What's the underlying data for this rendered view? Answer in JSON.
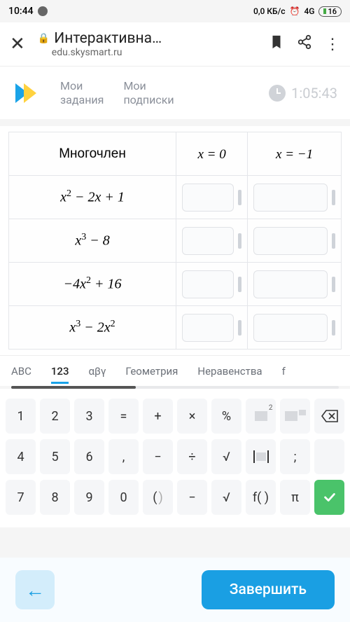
{
  "status": {
    "time": "10:44",
    "net_speed": "0,0 КБ/с",
    "signal": "4G",
    "battery": "16"
  },
  "browser": {
    "title": "Интерактивна…",
    "url": "edu.skysmart.ru"
  },
  "nav": {
    "tasks": "Мои\nзадания",
    "subs": "Мои\nподписки",
    "timer": "1:05:43"
  },
  "table": {
    "hdr_poly": "Многочлен",
    "hdr_c1": "x = 0",
    "hdr_c2": "x = −1",
    "rows": [
      {
        "poly_html": "x<sup>2</sup> − 2x + 1"
      },
      {
        "poly_html": "x<sup>3</sup> − 8"
      },
      {
        "poly_html": "−4x<sup>2</sup> + 16"
      },
      {
        "poly_html": "x<sup>3</sup> − 2x<sup>2</sup>"
      }
    ]
  },
  "kbd_tabs": {
    "t1": "ABC",
    "t2": "123",
    "t3": "αβγ",
    "t4": "Геометрия",
    "t5": "Неравенства",
    "t6": "f"
  },
  "keys": {
    "r1": [
      "1",
      "2",
      "3",
      "=",
      "+",
      "×",
      "%"
    ],
    "r2": [
      "4",
      "5",
      "6",
      ",",
      "−",
      "÷",
      "√"
    ],
    "r3": [
      "7",
      "8",
      "9",
      "0"
    ],
    "semicolon": ";",
    "minus_alt": "−",
    "root": "√",
    "fn": "f( )",
    "pi": "π",
    "paren_l": "(",
    "paren_r": ")"
  },
  "footer": {
    "finish": "Завершить"
  }
}
